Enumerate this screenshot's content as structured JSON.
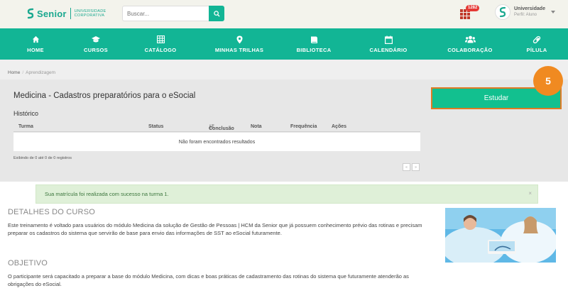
{
  "header": {
    "brand": "Senior",
    "brand_sub_1": "Universidade",
    "brand_sub_2": "Corporativa",
    "search_placeholder": "Buscar...",
    "notification_count": "1282",
    "profile_name": "Universidade",
    "profile_role": "Perfil: Aluno"
  },
  "nav": {
    "items": [
      {
        "label": "HOME",
        "icon": "home-icon"
      },
      {
        "label": "CURSOS",
        "icon": "graduation-cap-icon"
      },
      {
        "label": "CATÁLOGO",
        "icon": "grid-icon"
      },
      {
        "label": "MINHAS TRILHAS",
        "icon": "map-pin-icon"
      },
      {
        "label": "BIBLIOTECA",
        "icon": "book-icon"
      },
      {
        "label": "CALENDÁRIO",
        "icon": "calendar-icon"
      },
      {
        "label": "COLABORAÇÃO",
        "icon": "users-icon"
      },
      {
        "label": "PÍLULA",
        "icon": "pill-icon"
      }
    ]
  },
  "breadcrumb": {
    "home": "Home",
    "separator": "/",
    "current": "Aprendizagem"
  },
  "course": {
    "title": "Medicina - Cadastros preparatórios para o eSocial",
    "history_label": "Histórico",
    "columns": [
      "Turma",
      "Status",
      "Conclusão",
      "Nota",
      "Frequência",
      "Ações"
    ],
    "empty_message": "Não foram encontrados resultados",
    "records_info": "Exibindo de 0 até 0 de 0 registros",
    "study_button": "Estudar",
    "step_number": "5",
    "pager_prev": "«",
    "pager_next": "»"
  },
  "alert": {
    "message": "Sua matrícula foi realizada com sucesso na turma 1.",
    "close": "×"
  },
  "details": {
    "title": "DETALHES DO CURSO",
    "text": "Este treinamento é voltado para usuários do módulo Medicina da solução de Gestão de Pessoas | HCM da Senior que já possuem conhecimento prévio das rotinas e precisam preparar os cadastros do sistema que servirão de base para envio das informações de SST ao eSocial futuramente.",
    "objective_title": "OBJETIVO",
    "objective_text": "O participante será capacitado a preparar a base do módulo Medicina, com dicas e boas práticas de cadastramento das rotinas do sistema que futuramente atenderão as obrigações do eSocial."
  },
  "colors": {
    "brand_green": "#12b595",
    "button_green": "#12c08f",
    "highlight_orange": "#f08a21",
    "alert_bg": "#dff0d8"
  }
}
